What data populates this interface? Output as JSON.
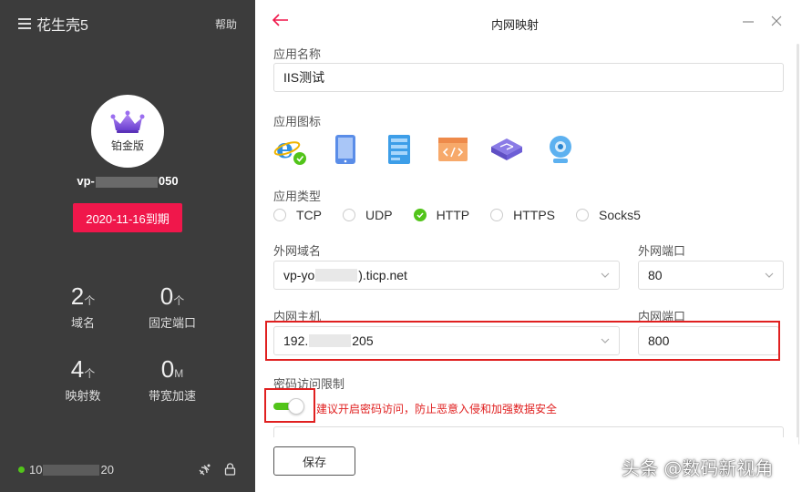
{
  "sidebar": {
    "app_title": "花生壳5",
    "help": "帮助",
    "edition": "铂金版",
    "account_prefix": "vp-",
    "account_suffix": "050",
    "expire": "2020-11-16到期",
    "stats": [
      {
        "num": "2",
        "unit": "个",
        "label": "域名"
      },
      {
        "num": "0",
        "unit": "个",
        "label": "固定端口"
      },
      {
        "num": "4",
        "unit": "个",
        "label": "映射数"
      },
      {
        "num": "0",
        "unit": "M",
        "label": "带宽加速"
      }
    ],
    "ip_prefix": "10",
    "ip_suffix": "20",
    "status_color": "#52c41a"
  },
  "dialog": {
    "title": "内网映射",
    "app_name_label": "应用名称",
    "app_name_value": "IIS测试",
    "app_icon_label": "应用图标",
    "app_icons": [
      "ie-icon",
      "tablet-icon",
      "server-icon",
      "code-window-icon",
      "network-switch-icon",
      "webcam-icon"
    ],
    "app_type_label": "应用类型",
    "app_types": [
      "TCP",
      "UDP",
      "HTTP",
      "HTTPS",
      "Socks5"
    ],
    "selected_type": "HTTP",
    "ext_domain_label": "外网域名",
    "ext_domain_prefix": "vp-yo",
    "ext_domain_suffix": ").ticp.net",
    "ext_port_label": "外网端口",
    "ext_port_value": "80",
    "int_host_label": "内网主机",
    "int_host_prefix": "192.",
    "int_host_suffix": "205",
    "int_port_label": "内网端口",
    "int_port_value": "800",
    "pwd_label": "密码访问限制",
    "pwd_warning": "建议开启密码访问，防止恶意入侵和加强数据安全",
    "pwd_value": "··········",
    "save": "保存"
  },
  "watermark": "头条 @数码新视角",
  "colors": {
    "accent_red": "#f0174b",
    "highlight_red": "#e02020",
    "green": "#52c41a",
    "sidebar_bg": "#3c3c3c"
  }
}
